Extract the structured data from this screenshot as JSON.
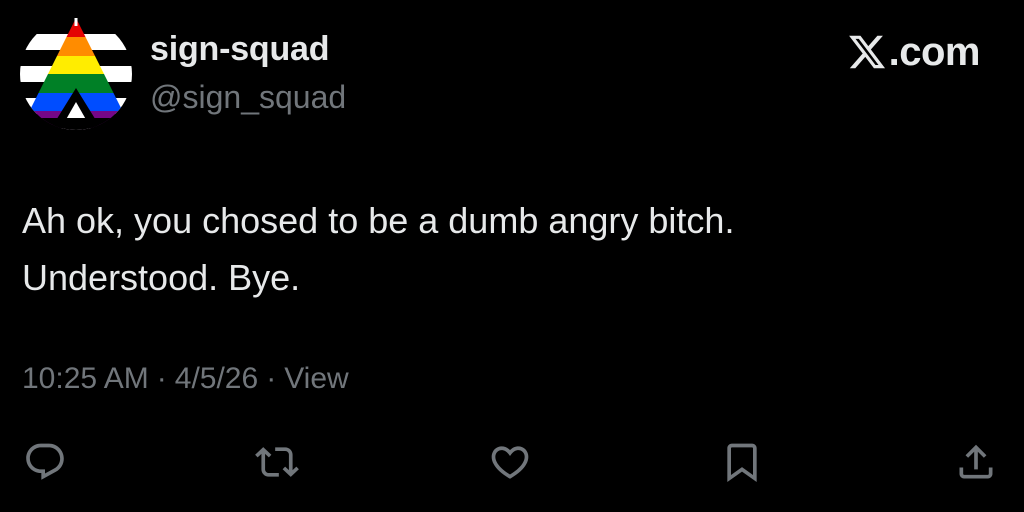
{
  "author": {
    "name": "sign-squad",
    "handle": "@sign_squad",
    "avatar": "ally-pride-flag-avatar"
  },
  "brand": {
    "text": ".com",
    "icon": "x-logo-icon"
  },
  "tweet": {
    "lines": [
      "Ah ok, you chosed to be a dumb angry bitch.",
      "Understood. Bye."
    ],
    "time": "10:25 AM",
    "sep1": "·",
    "date": "4/5/26",
    "sep2": "·",
    "views": "View"
  },
  "actions": [
    {
      "name": "reply",
      "icon": "reply-icon"
    },
    {
      "name": "retweet",
      "icon": "retweet-icon"
    },
    {
      "name": "like",
      "icon": "heart-icon"
    },
    {
      "name": "bookmark",
      "icon": "bookmark-icon"
    },
    {
      "name": "share",
      "icon": "share-icon"
    }
  ],
  "colors": {
    "background": "#000000",
    "primary_text": "#e7e9ea",
    "secondary_text": "#71767b",
    "flag": [
      "#e40303",
      "#ff8c00",
      "#ffed00",
      "#008026",
      "#004dff",
      "#750787"
    ]
  }
}
